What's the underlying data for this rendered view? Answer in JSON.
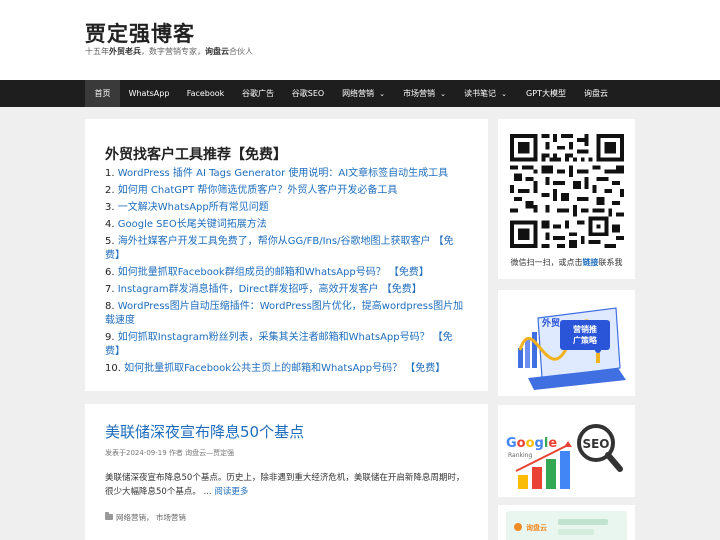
{
  "site": {
    "title": "贾定强博客",
    "tagline_prefix": "十五年",
    "tagline_bold1": "外贸老兵",
    "tagline_mid": "，数字营销专家，",
    "tagline_bold2": "询盘云",
    "tagline_suffix": "合伙人"
  },
  "nav": {
    "items": [
      {
        "label": "首页",
        "active": true
      },
      {
        "label": "WhatsApp"
      },
      {
        "label": "Facebook"
      },
      {
        "label": "谷歌广告"
      },
      {
        "label": "谷歌SEO"
      },
      {
        "label": "网络营销",
        "dropdown": true
      },
      {
        "label": "市场营销",
        "dropdown": true
      },
      {
        "label": "读书笔记",
        "dropdown": true
      },
      {
        "label": "GPT大模型"
      },
      {
        "label": "询盘云"
      }
    ],
    "caret": "⌄"
  },
  "tools": {
    "title": "外贸找客户工具推荐【免费】",
    "items": [
      {
        "num": "1.",
        "text": "WordPress 插件 AI Tags Generator 使用说明：AI文章标签自动生成工具"
      },
      {
        "num": "2.",
        "text": "如何用 ChatGPT 帮你筛选优质客户？外贸人客户开发必备工具"
      },
      {
        "num": "3.",
        "text": "一文解决WhatsApp所有常见问题"
      },
      {
        "num": "4.",
        "text": "Google SEO长尾关键词拓展方法"
      },
      {
        "num": "5.",
        "text": "海外社媒客户开发工具免费了，帮你从GG/FB/Ins/谷歌地图上获取客户 【免费】"
      },
      {
        "num": "6.",
        "text": "如何批量抓取Facebook群组成员的邮箱和WhatsApp号码？ 【免费】"
      },
      {
        "num": "7.",
        "text": "Instagram群发消息插件，Direct群发招呼，高效开发客户 【免费】"
      },
      {
        "num": "8.",
        "text": "WordPress图片自动压缩插件：WordPress图片优化，提高wordpress图片加载速度"
      },
      {
        "num": "9.",
        "text": "如何抓取Instagram粉丝列表，采集其关注者邮箱和WhatsApp号码？ 【免费】"
      },
      {
        "num": "10.",
        "text": "如何批量抓取Facebook公共主页上的邮箱和WhatsApp号码？ 【免费】"
      }
    ]
  },
  "post": {
    "title": "美联储深夜宣布降息50个基点",
    "meta": "发表于2024-09-19 作者 询盘云—贾定强",
    "excerpt": "美联储深夜宣布降息50个基点。历史上，除非遇到重大经济危机，美联储在开启新降息周期时，很少大幅降息50个基点。 ...",
    "read_more": "阅读更多",
    "categories": "网络营销，  市场营销"
  },
  "sidebar": {
    "qr_caption_prefix": "微信扫一扫，或点击",
    "qr_caption_link": "链接",
    "qr_caption_suffix": "联系我",
    "ad1_text": "外贸",
    "ad1_badge_line1": "营销推",
    "ad1_badge_line2": "广策略",
    "ad2_brand": "Google",
    "ad2_sub": "Ranking",
    "ad2_badge": "SEO",
    "ad3_brand": "询盘云"
  },
  "colors": {
    "link": "#1e6dbd",
    "nav_bg": "#1e1e1e",
    "nav_active": "#3a3a3a"
  }
}
